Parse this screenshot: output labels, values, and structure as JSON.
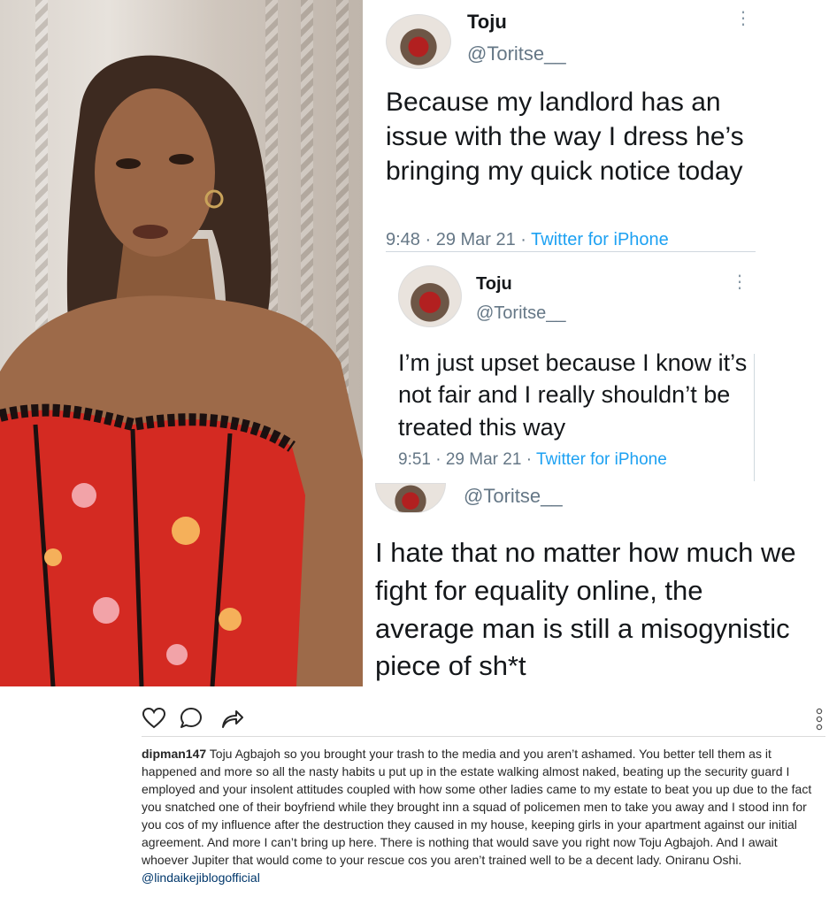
{
  "tweets": [
    {
      "name": "Toju",
      "handle": "@Toritse__",
      "menu_icon": "more-vertical-icon",
      "text": "Because my landlord has an issue with the way I dress he’s bringing my quick notice today",
      "time": "9:48 · 29 Mar 21 · ",
      "source": "Twitter for iPhone"
    },
    {
      "name": "Toju",
      "handle": "@Toritse__",
      "menu_icon": "more-vertical-icon",
      "text": "I’m just upset because I know it’s not fair and I really shouldn’t be treated this way",
      "time": "9:51 · 29 Mar 21 · ",
      "source": "Twitter for iPhone"
    },
    {
      "handle": "@Toritse__",
      "text": "I hate that no matter how much we fight for equality online, the average man is still a misogynistic piece of sh*t"
    }
  ],
  "actions": {
    "like_icon": "heart-icon",
    "comment_icon": "comment-icon",
    "share_icon": "share-icon",
    "more_icon": "more-vertical-icon"
  },
  "caption": {
    "username": "dipman147",
    "text": "Toju Agbajoh so you brought your trash to the media and you aren’t ashamed. You better tell them as it happened and more so all the nasty habits u put up in the estate walking almost naked, beating up the security guard I employed and your insolent attitudes coupled with how some other ladies came to my estate to beat you up due to the fact you snatched one of their boyfriend while they brought inn a squad of policemen men to take you away and I stood inn for you cos of my influence after the destruction they caused in my house, keeping girls in your apartment against our initial agreement. And more I can’t bring up here. There is nothing that would save you right now Toju Agbajoh. And I await whoever Jupiter that would come to your rescue cos you aren’t trained well to be a decent lady. Oniranu Oshi.",
    "mention": "@lindaikejiblogofficial"
  },
  "colors": {
    "twitter_blue": "#1da1f2",
    "tweet_text": "#14171a",
    "tweet_meta": "#657786",
    "mention": "#00376b",
    "corset_red": "#d42a22"
  }
}
